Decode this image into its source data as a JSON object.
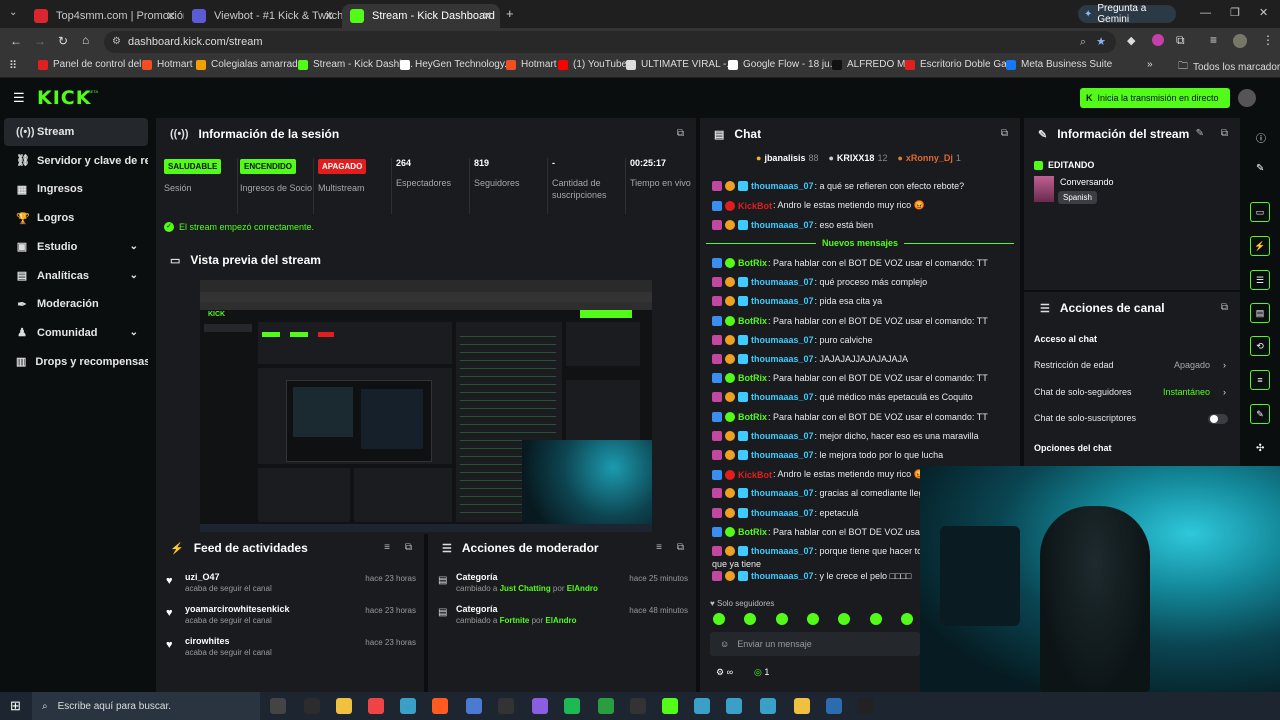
{
  "browser": {
    "tabs": [
      {
        "title": "Top4smm.com | Promoción de ...",
        "color": "#d9262f"
      },
      {
        "title": "Viewbot - #1 Kick & Twitch Vie...",
        "color": "#5b5bd6"
      },
      {
        "title": "Stream - Kick Dashboard",
        "color": "#53fc18"
      }
    ],
    "gemini_label": "Pregunta a Gemini",
    "url": "dashboard.kick.com/stream",
    "bookmarks": [
      {
        "label": "Panel de control del...",
        "color": "#e02020"
      },
      {
        "label": "Hotmart",
        "color": "#f04e23"
      },
      {
        "label": "Colegialas amarradas",
        "color": "#f0a000"
      },
      {
        "label": "Stream - Kick Dashb...",
        "color": "#53fc18"
      },
      {
        "label": "HeyGen Technology...",
        "color": "#ffffff"
      },
      {
        "label": "Hotmart",
        "color": "#f04e23"
      },
      {
        "label": "(1) YouTube",
        "color": "#ff0000"
      },
      {
        "label": "ULTIMATE VIRAL -...",
        "color": "#dddddd"
      },
      {
        "label": "Google Flow - 18 ju...",
        "color": "#ffffff"
      },
      {
        "label": "ALFREDO MX",
        "color": "#111111"
      },
      {
        "label": "Escritorio Doble Ga...",
        "color": "#e02020"
      },
      {
        "label": "Meta Business Suite",
        "color": "#1877f2"
      }
    ],
    "all_bookmarks": "Todos los marcadores"
  },
  "kick": {
    "logo": "KICK",
    "go_live": "Inicia la transmisión en directo"
  },
  "sidebar": {
    "items": [
      {
        "label": "Stream",
        "icon": "signal-icon",
        "glyph": "((•))",
        "active": true,
        "chev": false
      },
      {
        "label": "Servidor y clave de retransmisión",
        "icon": "link-icon",
        "glyph": "⛓",
        "active": false,
        "chev": false
      },
      {
        "label": "Ingresos",
        "icon": "revenue-icon",
        "glyph": "▦",
        "active": false,
        "chev": false
      },
      {
        "label": "Logros",
        "icon": "trophy-icon",
        "glyph": "🏆",
        "active": false,
        "chev": false
      },
      {
        "label": "Estudio",
        "icon": "studio-icon",
        "glyph": "▣",
        "active": false,
        "chev": true
      },
      {
        "label": "Analíticas",
        "icon": "analytics-icon",
        "glyph": "▤",
        "active": false,
        "chev": true
      },
      {
        "label": "Moderación",
        "icon": "hammer-icon",
        "glyph": "✒",
        "active": false,
        "chev": false
      },
      {
        "label": "Comunidad",
        "icon": "community-icon",
        "glyph": "♟",
        "active": false,
        "chev": true
      },
      {
        "label": "Drops y recompensas",
        "icon": "drops-icon",
        "glyph": "▥",
        "active": false,
        "chev": false
      }
    ]
  },
  "session": {
    "title": "Información de la sesión",
    "stats": [
      {
        "badge": "SALUDABLE",
        "badge_color": "#53fc18",
        "label": "Sesión"
      },
      {
        "badge": "ENCENDIDO",
        "badge_color": "#53fc18",
        "label": "Ingresos de Socio"
      },
      {
        "badge": "APAGADO",
        "badge_color": "#e01e1e",
        "label": "Multistream"
      },
      {
        "value": "264",
        "label": "Espectadores"
      },
      {
        "value": "819",
        "label": "Seguidores"
      },
      {
        "value": "-",
        "label": "Cantidad de suscripciones"
      },
      {
        "value": "00:25:17",
        "label": "Tiempo en vivo"
      }
    ],
    "success": "El stream empezó correctamente."
  },
  "preview": {
    "title": "Vista previa del stream"
  },
  "feed": {
    "title": "Feed de actividades",
    "items": [
      {
        "name": "uzi_O47",
        "sub": "acaba de seguir el canal",
        "time": "hace 23 horas"
      },
      {
        "name": "yoamarcirowhitesenkick",
        "sub": "acaba de seguir el canal",
        "time": "hace 23 horas"
      },
      {
        "name": "cirowhites",
        "sub": "acaba de seguir el canal",
        "time": "hace 23 horas"
      }
    ]
  },
  "modactions": {
    "title": "Acciones de moderador",
    "items": [
      {
        "name": "Categoría",
        "pre": "cambiado a ",
        "cat": "Just Chatting",
        "mid": " por ",
        "by": "ElAndro",
        "time": "hace 25 minutos"
      },
      {
        "name": "Categoría",
        "pre": "cambiado a ",
        "cat": "Fortnite",
        "mid": " por ",
        "by": "ElAndro",
        "time": "hace 48 minutos"
      }
    ]
  },
  "chat": {
    "title": "Chat",
    "top": [
      {
        "name": "jbanalisis",
        "count": "88"
      },
      {
        "name": "KRIXX18",
        "count": "12"
      },
      {
        "name": "xRonny_Dj",
        "count": "1"
      }
    ],
    "messages": [
      {
        "user": "thoumaaas_07",
        "color": "#3ecbff",
        "text": ": a qué se refieren con efecto rebote?"
      },
      {
        "user": "KickBot",
        "color": "#e01e1e",
        "text": ": Andro le estas metiendo muy rico 😡"
      },
      {
        "user": "thoumaaas_07",
        "color": "#3ecbff",
        "text": ": eso está bien"
      }
    ],
    "new_messages": "Nuevos mensajes",
    "messages2": [
      {
        "user": "BotRix",
        "color": "#53fc18",
        "text": ": Para hablar con el BOT DE VOZ usar el comando: TT"
      },
      {
        "user": "thoumaaas_07",
        "color": "#3ecbff",
        "text": ": qué proceso más complejo"
      },
      {
        "user": "thoumaaas_07",
        "color": "#3ecbff",
        "text": ": pida esa cita ya"
      },
      {
        "user": "BotRix",
        "color": "#53fc18",
        "text": ": Para hablar con el BOT DE VOZ usar el comando: TT"
      },
      {
        "user": "thoumaaas_07",
        "color": "#3ecbff",
        "text": ": puro calviche"
      },
      {
        "user": "thoumaaas_07",
        "color": "#3ecbff",
        "text": ": JAJAJAJJAJAJAJAJA"
      },
      {
        "user": "BotRix",
        "color": "#53fc18",
        "text": ": Para hablar con el BOT DE VOZ usar el comando: TT"
      },
      {
        "user": "thoumaaas_07",
        "color": "#3ecbff",
        "text": ": qué médico más epetaculá es Coquito"
      },
      {
        "user": "BotRix",
        "color": "#53fc18",
        "text": ": Para hablar con el BOT DE VOZ usar el comando: TT"
      },
      {
        "user": "thoumaaas_07",
        "color": "#3ecbff",
        "text": ": mejor dicho, hacer eso es una maravilla"
      },
      {
        "user": "thoumaaas_07",
        "color": "#3ecbff",
        "text": ": le mejora todo por lo que lucha"
      },
      {
        "user": "KickBot",
        "color": "#e01e1e",
        "text": ": Andro le estas metiendo muy rico 😡"
      },
      {
        "user": "thoumaaas_07",
        "color": "#3ecbff",
        "text": ": gracias al comediante llega"
      },
      {
        "user": "thoumaaas_07",
        "color": "#3ecbff",
        "text": ": epetaculá"
      },
      {
        "user": "BotRix",
        "color": "#53fc18",
        "text": ": Para hablar con el BOT DE VOZ usar el"
      },
      {
        "user": "thoumaaas_07",
        "color": "#3ecbff",
        "text": ": porque tiene que hacer to"
      },
      {
        "user": "",
        "color": "#eaeaea",
        "text": "que ya tiene"
      },
      {
        "user": "thoumaaas_07",
        "color": "#3ecbff",
        "text": ": y le crece el pelo □□□□"
      }
    ],
    "followers_only": "Solo seguidores",
    "input_placeholder": "Enviar un mensaje",
    "infinity": "∞",
    "points": "1"
  },
  "stream_info": {
    "title": "Información del stream",
    "editing": "EDITANDO",
    "category": "Conversando",
    "language": "Spanish"
  },
  "channel_actions": {
    "title": "Acciones de canal",
    "chat_access": "Acceso al chat",
    "rows": [
      {
        "label": "Restricción de edad",
        "value": "Apagado",
        "value_color": "#a8a8a8"
      },
      {
        "label": "Chat de solo-seguidores",
        "value": "Instantáneo",
        "value_color": "#53fc18"
      },
      {
        "label": "Chat de solo-suscriptores",
        "value": "",
        "value_color": "#a8a8a8"
      }
    ],
    "chat_options": "Opciones del chat"
  },
  "taskbar": {
    "search_placeholder": "Escribe aquí para buscar."
  },
  "colors": {
    "accent": "#53fc18",
    "panel": "#191b1f",
    "bg": "#0b0e0f",
    "danger": "#e01e1e"
  }
}
